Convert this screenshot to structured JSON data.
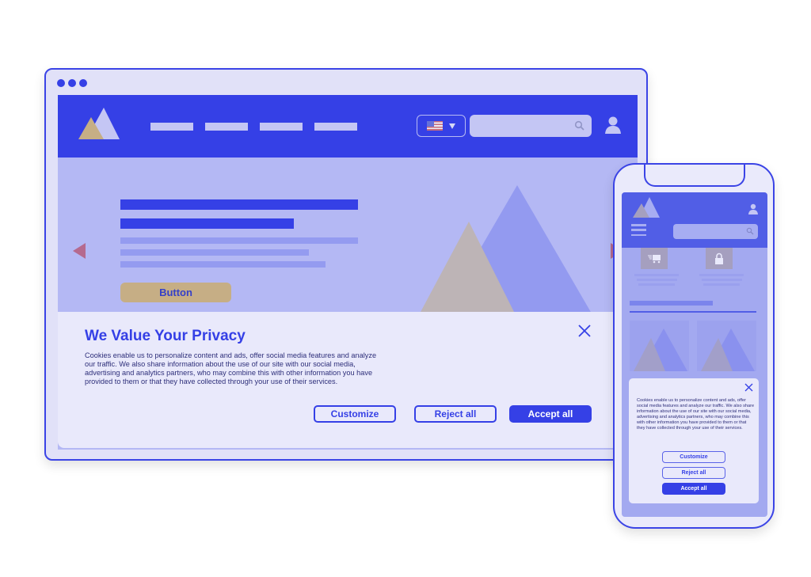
{
  "colors": {
    "brand": "#3540e6",
    "frame": "#e1e1f8",
    "hero_bg": "#b4b8f4",
    "button_gold": "#c6ae85",
    "arrow": "#b56a8f"
  },
  "browser": {
    "window_controls": [
      "dot",
      "dot",
      "dot"
    ],
    "header": {
      "logo": "mountain-logo",
      "nav_items": [
        "",
        "",
        "",
        ""
      ],
      "language_selector": {
        "icon": "us-flag-icon",
        "caret": "caret-down-icon"
      },
      "search": {
        "placeholder": "",
        "value": "",
        "icon": "search-icon"
      },
      "account_icon": "user-icon"
    },
    "hero": {
      "button_label": "Button",
      "prev_arrow": "arrow-left-icon",
      "next_arrow": "arrow-right-icon",
      "image": "mountains-illustration"
    },
    "cookie_banner": {
      "title": "We Value Your Privacy",
      "text": "Cookies enable us to personalize content and ads, offer social media features and analyze our traffic. We also share information about the use of our site with our social media, advertising and analytics partners, who may combine this with other information you have provided to them or that they have collected through your use of their services.",
      "buttons": {
        "customize": "Customize",
        "reject": "Reject all",
        "accept": "Accept all"
      },
      "close_icon": "close-icon"
    }
  },
  "phone": {
    "header": {
      "logo": "mountain-logo",
      "account_icon": "user-icon",
      "menu_icon": "hamburger-icon",
      "search": {
        "placeholder": "",
        "value": "",
        "icon": "search-icon"
      }
    },
    "features": [
      {
        "icon": "delivery-truck-icon"
      },
      {
        "icon": "lock-icon"
      }
    ],
    "cookie_banner": {
      "text": "Cookies enable us to personalize content and ads, offer social media features and analyze our traffic. We also share information about the use of our site with our social media, advertising and analytics partners, who may combine this with other information you have provided to them or that they have collected through your use of their services.",
      "buttons": {
        "customize": "Customize",
        "reject": "Reject all",
        "accept": "Accept all"
      },
      "close_icon": "close-icon"
    }
  }
}
